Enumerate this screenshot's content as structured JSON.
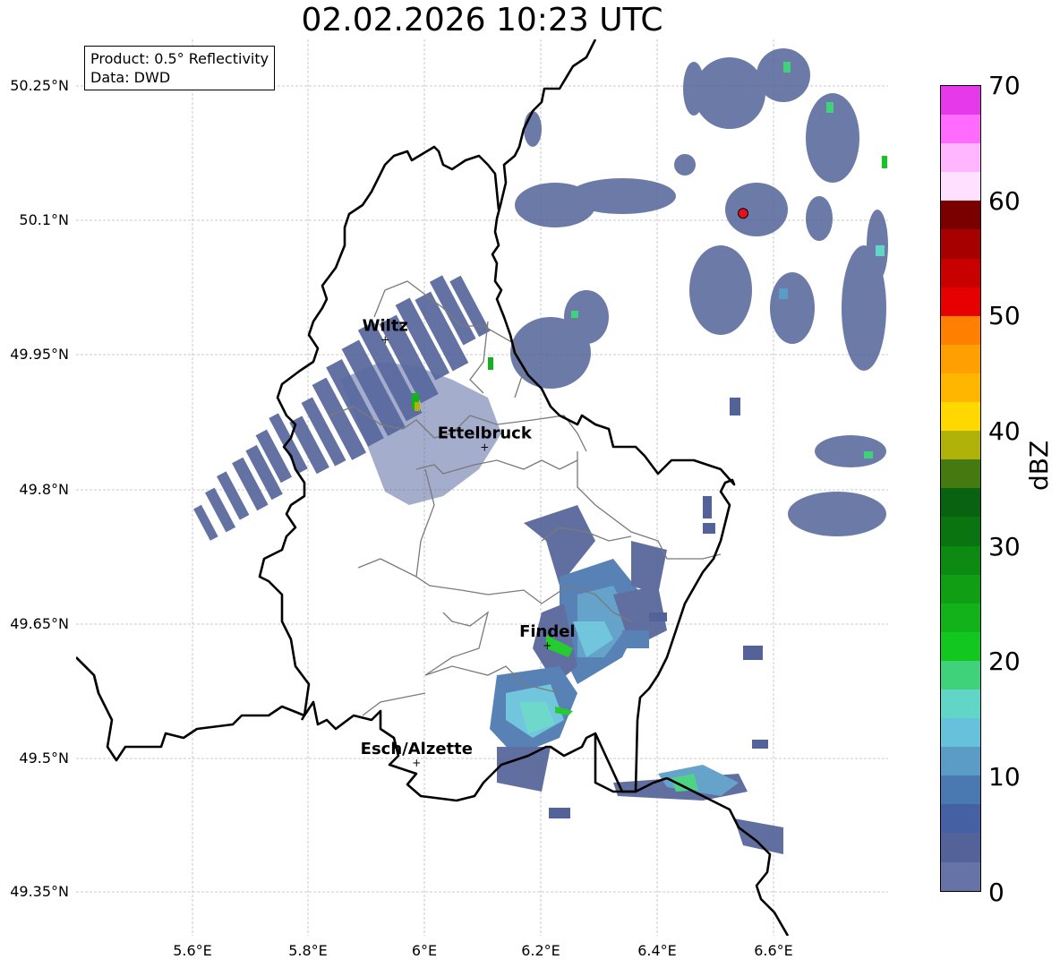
{
  "title": "02.02.2026 10:23 UTC",
  "info_box": {
    "product": "Product: 0.5° Reflectivity",
    "data": "Data: DWD"
  },
  "lat_labels": [
    "50.25°N",
    "50.1°N",
    "49.95°N",
    "49.8°N",
    "49.65°N",
    "49.5°N",
    "49.35°N"
  ],
  "lon_labels": [
    "5.6°E",
    "5.8°E",
    "6°E",
    "6.2°E",
    "6.4°E",
    "6.6°E"
  ],
  "cities": [
    {
      "name": "Wiltz",
      "lat": 49.968,
      "lon": 5.932
    },
    {
      "name": "Ettelbruck",
      "lat": 49.848,
      "lon": 6.103
    },
    {
      "name": "Findel",
      "lat": 49.627,
      "lon": 6.211
    },
    {
      "name": "Esch/Alzette",
      "lat": 49.496,
      "lon": 5.986
    }
  ],
  "radar_site": {
    "lat": 50.109,
    "lon": 6.548,
    "color": "#e8101a"
  },
  "colorbar": {
    "label": "dBZ",
    "ticks": [
      "0",
      "10",
      "20",
      "30",
      "40",
      "50",
      "60",
      "70"
    ],
    "colors": [
      "#6673a6",
      "#536399",
      "#4560a3",
      "#4a78b0",
      "#5a9cc6",
      "#66c1da",
      "#62d6c6",
      "#40d27a",
      "#12c81e",
      "#12b21a",
      "#0f9e14",
      "#0c8a12",
      "#0a7510",
      "#076310",
      "#457a10",
      "#b0b20a",
      "#ffd800",
      "#ffb600",
      "#ffa000",
      "#ff8000",
      "#e60000",
      "#c80000",
      "#a60000",
      "#7a0000",
      "#ffe0ff",
      "#ffb6ff",
      "#ff6aff",
      "#e63aea"
    ]
  }
}
